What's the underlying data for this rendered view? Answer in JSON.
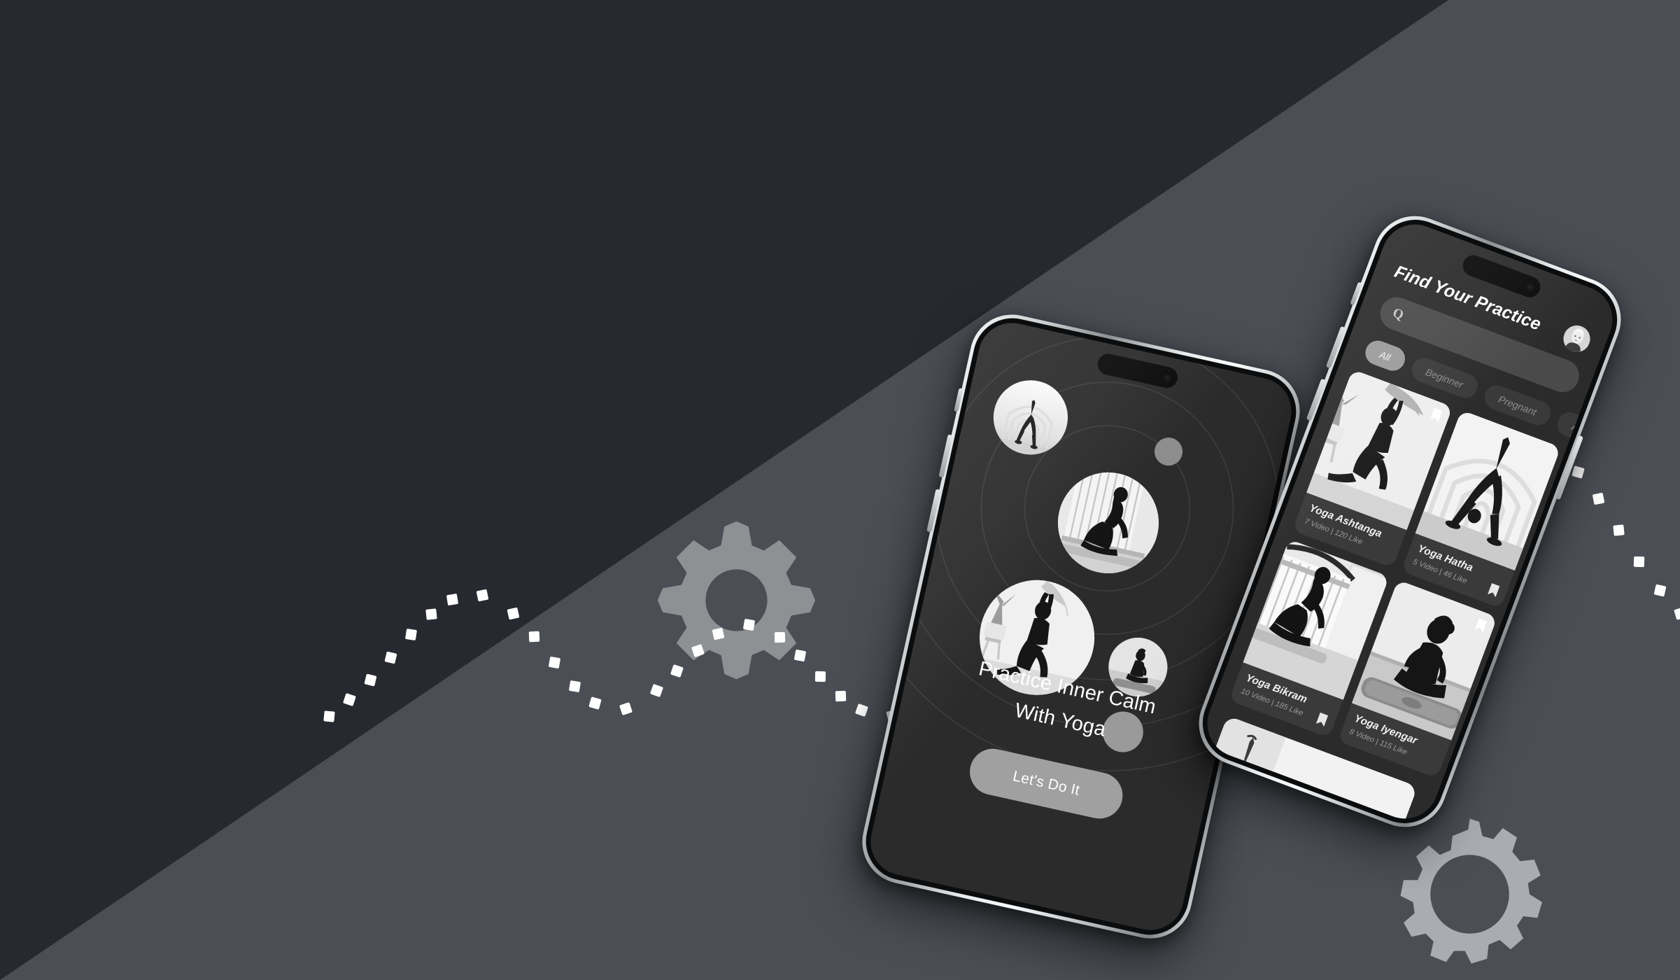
{
  "background": {
    "dark_color": "#26292f",
    "light_color": "#4b4e55",
    "gear_left_color": "#8e9194",
    "gear_right_color": "#a9acb1",
    "dot_color": "#ffffff"
  },
  "phone_left": {
    "app_screen": "onboarding",
    "headline_line1": "Practice Inner Calm",
    "headline_line2": "With Yoga",
    "cta_label": "Let's Do It"
  },
  "phone_right": {
    "app_screen": "browse",
    "title": "Find Your Practice",
    "search": {
      "placeholder": "",
      "value": "",
      "icon": "search-icon"
    },
    "chips": [
      {
        "label": "All",
        "active": true
      },
      {
        "label": "Beginner",
        "active": false
      },
      {
        "label": "Pregnant",
        "active": false
      },
      {
        "label": "Advanced",
        "active": false
      }
    ],
    "cards": [
      {
        "title": "Yoga Ashtanga",
        "meta": "7 Video  |  120 Like",
        "bookmark": "light"
      },
      {
        "title": "Yoga Hatha",
        "meta": "5 Video  |  46 Like",
        "bookmark": "dark"
      },
      {
        "title": "Yoga Bikram",
        "meta": "10 Video  |  185 Like",
        "bookmark": "dark"
      },
      {
        "title": "Yoga Iyengar",
        "meta": "8 Video  |  115 Like",
        "bookmark": "light"
      }
    ]
  }
}
